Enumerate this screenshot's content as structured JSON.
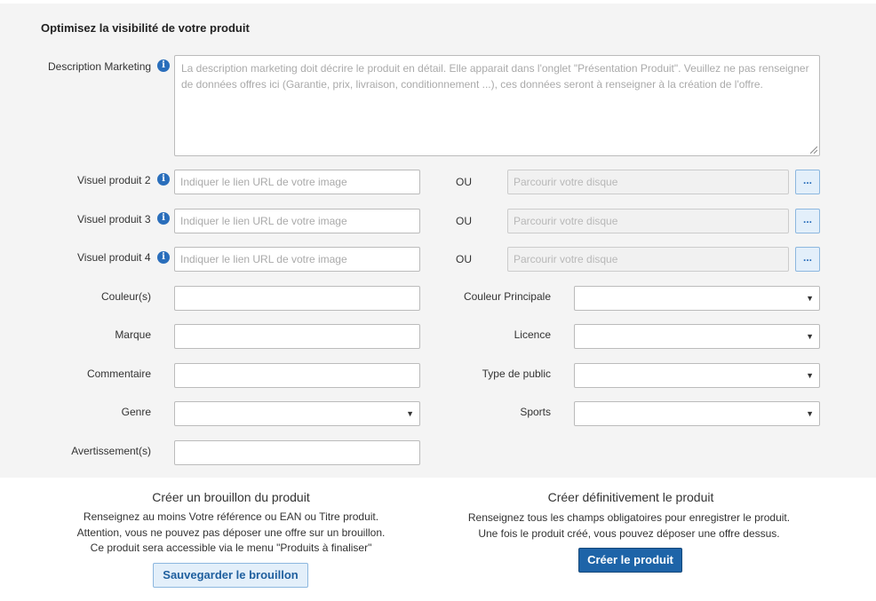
{
  "section": {
    "title": "Optimisez la visibilité de votre produit"
  },
  "description": {
    "label": "Description Marketing",
    "placeholder": "La description marketing doit décrire le produit en détail. Elle apparait dans l'onglet \"Présentation Produit\". Veuillez ne pas renseigner de données offres ici (Garantie, prix, livraison, conditionnement ...), ces données seront à renseigner à la création de l'offre."
  },
  "visuals": [
    {
      "label": "Visuel produit 2",
      "url_placeholder": "Indiquer le lien URL de votre image",
      "or": "OU",
      "browse_placeholder": "Parcourir votre disque",
      "browse_button": "..."
    },
    {
      "label": "Visuel produit 3",
      "url_placeholder": "Indiquer le lien URL de votre image",
      "or": "OU",
      "browse_placeholder": "Parcourir votre disque",
      "browse_button": "..."
    },
    {
      "label": "Visuel produit 4",
      "url_placeholder": "Indiquer le lien URL de votre image",
      "or": "OU",
      "browse_placeholder": "Parcourir votre disque",
      "browse_button": "..."
    }
  ],
  "fields": {
    "couleurs": "Couleur(s)",
    "couleur_principale": "Couleur Principale",
    "marque": "Marque",
    "licence": "Licence",
    "commentaire": "Commentaire",
    "type_public": "Type de public",
    "genre": "Genre",
    "sports": "Sports",
    "avertissements": "Avertissement(s)"
  },
  "icons": {
    "info": "info-icon",
    "dropdown": "dropdown-caret-icon",
    "info_color": "#2a6ebb"
  },
  "draft": {
    "title": "Créer un brouillon du produit",
    "lines": [
      "Renseignez au moins Votre référence ou EAN ou Titre produit.",
      "Attention, vous ne pouvez pas déposer une offre sur un brouillon.",
      "Ce produit sera accessible via le menu \"Produits à finaliser\""
    ],
    "button": "Sauvegarder le brouillon"
  },
  "create": {
    "title": "Créer définitivement le produit",
    "lines": [
      "Renseignez tous les champs obligatoires pour enregistrer le produit.",
      "Une fois le produit créé, vous pouvez déposer une offre dessus."
    ],
    "button": "Créer le produit"
  },
  "colors": {
    "panel_bg": "#f4f4f4",
    "primary_button": "#1e64a8",
    "secondary_button": "#e3effa"
  }
}
